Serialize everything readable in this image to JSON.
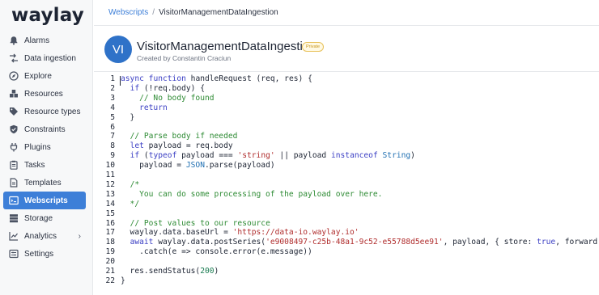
{
  "sidebar": {
    "logo": "waylay",
    "items": [
      {
        "label": "Alarms",
        "icon": "bell-icon"
      },
      {
        "label": "Data ingestion",
        "icon": "ingestion-icon"
      },
      {
        "label": "Explore",
        "icon": "compass-icon"
      },
      {
        "label": "Resources",
        "icon": "cubes-icon"
      },
      {
        "label": "Resource types",
        "icon": "tag-icon"
      },
      {
        "label": "Constraints",
        "icon": "shield-icon"
      },
      {
        "label": "Plugins",
        "icon": "plug-icon"
      },
      {
        "label": "Tasks",
        "icon": "clipboard-icon"
      },
      {
        "label": "Templates",
        "icon": "document-icon"
      },
      {
        "label": "Webscripts",
        "icon": "code-icon",
        "active": true
      },
      {
        "label": "Storage",
        "icon": "database-icon"
      },
      {
        "label": "Analytics",
        "icon": "chart-icon",
        "has_submenu": true
      },
      {
        "label": "Settings",
        "icon": "settings-icon"
      }
    ]
  },
  "breadcrumb": {
    "parent": "Webscripts",
    "separator": "/",
    "current": "VisitorManagementDataIngestion"
  },
  "script": {
    "avatar_initials": "VI",
    "title": "VisitorManagementDataIngestion",
    "badge": "Private",
    "subtitle": "Created by Constantin Craciun"
  },
  "code": {
    "line_numbers": [
      "1",
      "2",
      "3",
      "4",
      "5",
      "6",
      "7",
      "8",
      "9",
      "10",
      "11",
      "12",
      "13",
      "14",
      "15",
      "16",
      "17",
      "18",
      "19",
      "20",
      "21",
      "22"
    ],
    "lines": [
      [
        {
          "t": "kw",
          "v": "async"
        },
        {
          "t": "p",
          "v": " "
        },
        {
          "t": "kw",
          "v": "function"
        },
        {
          "t": "p",
          "v": " handleRequest (req, res) {"
        }
      ],
      [
        {
          "t": "p",
          "v": "  "
        },
        {
          "t": "kw",
          "v": "if"
        },
        {
          "t": "p",
          "v": " (!req.body) {"
        }
      ],
      [
        {
          "t": "p",
          "v": "    "
        },
        {
          "t": "cmt",
          "v": "// No body found"
        }
      ],
      [
        {
          "t": "p",
          "v": "    "
        },
        {
          "t": "kw",
          "v": "return"
        }
      ],
      [
        {
          "t": "p",
          "v": "  }"
        }
      ],
      [],
      [
        {
          "t": "p",
          "v": "  "
        },
        {
          "t": "cmt",
          "v": "// Parse body if needed"
        }
      ],
      [
        {
          "t": "p",
          "v": "  "
        },
        {
          "t": "kw",
          "v": "let"
        },
        {
          "t": "p",
          "v": " payload = req.body"
        }
      ],
      [
        {
          "t": "p",
          "v": "  "
        },
        {
          "t": "kw",
          "v": "if"
        },
        {
          "t": "p",
          "v": " ("
        },
        {
          "t": "kw",
          "v": "typeof"
        },
        {
          "t": "p",
          "v": " payload === "
        },
        {
          "t": "str",
          "v": "'string'"
        },
        {
          "t": "p",
          "v": " || payload "
        },
        {
          "t": "kw",
          "v": "instanceof"
        },
        {
          "t": "p",
          "v": " "
        },
        {
          "t": "type",
          "v": "String"
        },
        {
          "t": "p",
          "v": ")"
        }
      ],
      [
        {
          "t": "p",
          "v": "    payload = "
        },
        {
          "t": "type",
          "v": "JSON"
        },
        {
          "t": "p",
          "v": ".parse(payload)"
        }
      ],
      [],
      [
        {
          "t": "p",
          "v": "  "
        },
        {
          "t": "cmt",
          "v": "/*"
        }
      ],
      [
        {
          "t": "cmt",
          "v": "    You can do some processing of the payload over here."
        }
      ],
      [
        {
          "t": "cmt",
          "v": "  */"
        }
      ],
      [],
      [
        {
          "t": "p",
          "v": "  "
        },
        {
          "t": "cmt",
          "v": "// Post values to our resource"
        }
      ],
      [
        {
          "t": "p",
          "v": "  waylay.data.baseUrl = "
        },
        {
          "t": "str",
          "v": "'https://data-io.waylay.io'"
        }
      ],
      [
        {
          "t": "p",
          "v": "  "
        },
        {
          "t": "kw",
          "v": "await"
        },
        {
          "t": "p",
          "v": " waylay.data.postSeries("
        },
        {
          "t": "str",
          "v": "'e9008497-c25b-48a1-9c52-e55788d5ee91'"
        },
        {
          "t": "p",
          "v": ", payload, { store: "
        },
        {
          "t": "bool",
          "v": "true"
        },
        {
          "t": "p",
          "v": ", forward: "
        },
        {
          "t": "bool",
          "v": "true"
        },
        {
          "t": "p",
          "v": " })"
        }
      ],
      [
        {
          "t": "p",
          "v": "    .catch(e => console.error(e.message))"
        }
      ],
      [],
      [
        {
          "t": "p",
          "v": "  res.sendStatus("
        },
        {
          "t": "num",
          "v": "200"
        },
        {
          "t": "p",
          "v": ")"
        }
      ],
      [
        {
          "t": "p",
          "v": "}"
        }
      ]
    ]
  },
  "colors": {
    "accent": "#3d7fd8",
    "avatar": "#2f72c8",
    "badge_border": "#e8c15a",
    "keyword": "#3b3fc4",
    "string": "#b02d2d",
    "comment": "#2e8b34"
  }
}
